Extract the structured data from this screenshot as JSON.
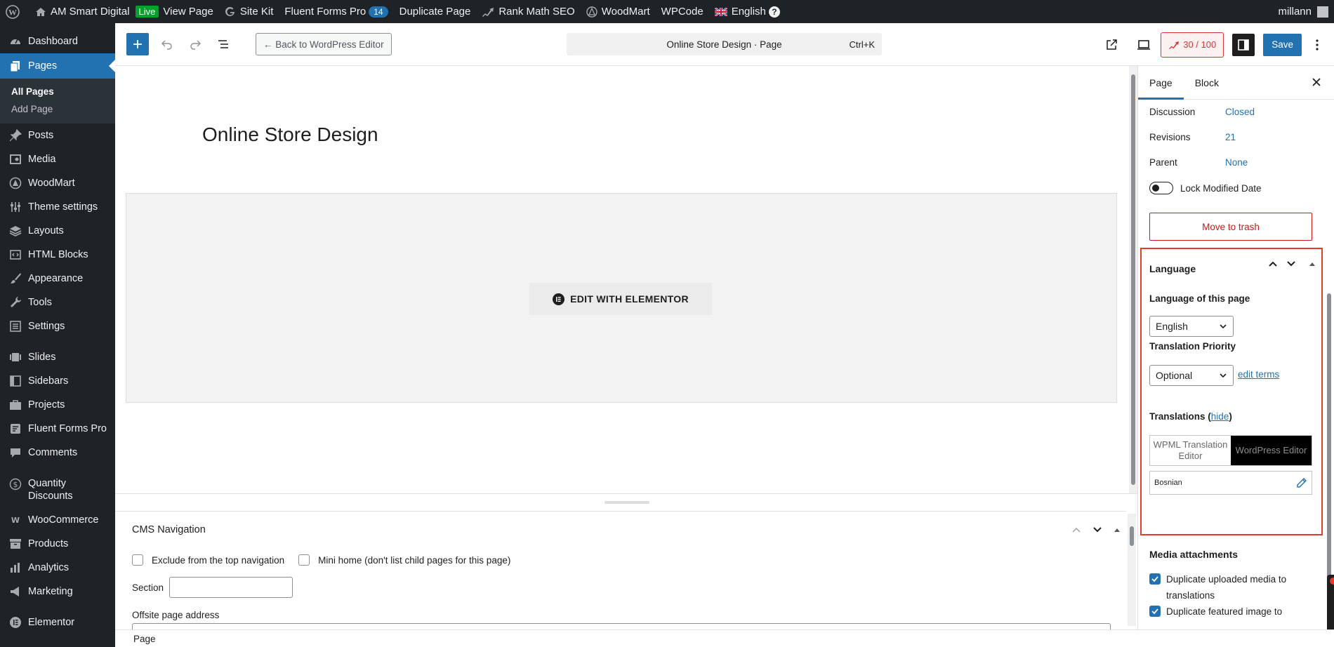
{
  "adminbar": {
    "site_name": "AM Smart Digital",
    "live_badge": "Live",
    "view_page": "View Page",
    "site_kit": "Site Kit",
    "fluent_forms": "Fluent Forms Pro",
    "fluent_count": "14",
    "duplicate_page": "Duplicate Page",
    "rank_math": "Rank Math SEO",
    "woodmart": "WoodMart",
    "wpcode": "WPCode",
    "language": "English",
    "help": "?",
    "user": "millann"
  },
  "sidebar": {
    "items": [
      {
        "label": "Dashboard",
        "icon": "dashboard-icon"
      },
      {
        "label": "Pages",
        "icon": "pages-icon"
      },
      {
        "label": "Posts",
        "icon": "pin-icon"
      },
      {
        "label": "Media",
        "icon": "media-icon"
      },
      {
        "label": "WoodMart",
        "icon": "woodmart-icon"
      },
      {
        "label": "Theme settings",
        "icon": "sliders-icon"
      },
      {
        "label": "Layouts",
        "icon": "layers-icon"
      },
      {
        "label": "HTML Blocks",
        "icon": "code-icon"
      },
      {
        "label": "Appearance",
        "icon": "brush-icon"
      },
      {
        "label": "Tools",
        "icon": "wrench-icon"
      },
      {
        "label": "Settings",
        "icon": "settings-icon"
      },
      {
        "label": "Slides",
        "icon": "slides-icon"
      },
      {
        "label": "Sidebars",
        "icon": "sidebar-icon"
      },
      {
        "label": "Projects",
        "icon": "briefcase-icon"
      },
      {
        "label": "Fluent Forms Pro",
        "icon": "form-icon"
      },
      {
        "label": "Comments",
        "icon": "comment-icon"
      },
      {
        "label": "Quantity Discounts",
        "icon": "dollar-icon"
      },
      {
        "label": "WooCommerce",
        "icon": "woo-icon"
      },
      {
        "label": "Products",
        "icon": "archive-icon"
      },
      {
        "label": "Analytics",
        "icon": "chart-icon"
      },
      {
        "label": "Marketing",
        "icon": "megaphone-icon"
      },
      {
        "label": "Elementor",
        "icon": "elementor-icon"
      }
    ],
    "submenu": [
      "All Pages",
      "Add Page"
    ]
  },
  "header": {
    "back_button": "← Back to WordPress Editor",
    "command_title": "Online Store Design · Page",
    "shortcut": "Ctrl+K",
    "seo_score": "30 / 100",
    "save": "Save"
  },
  "canvas": {
    "page_title": "Online Store Design",
    "elementor_button": "EDIT WITH ELEMENTOR"
  },
  "metabox": {
    "title": "CMS Navigation",
    "exclude_label": "Exclude from the top navigation",
    "mini_home_label": "Mini home (don't list child pages for this page)",
    "section_label": "Section",
    "offsite_label": "Offsite page address"
  },
  "footer": {
    "breadcrumb": "Page"
  },
  "settings": {
    "tabs": [
      "Page",
      "Block"
    ],
    "discussion_label": "Discussion",
    "discussion_value": "Closed",
    "revisions_label": "Revisions",
    "revisions_value": "21",
    "parent_label": "Parent",
    "parent_value": "None",
    "lock_label": "Lock Modified Date",
    "trash": "Move to trash",
    "language": {
      "title": "Language",
      "this_page_label": "Language of this page",
      "selected_language": "English",
      "priority_label": "Translation Priority",
      "selected_priority": "Optional",
      "edit_terms": "edit terms",
      "translations_label": "Translations (",
      "hide": "hide",
      "translations_close": ")",
      "tab_wpml": "WPML Translation Editor",
      "tab_wp": "WordPress Editor",
      "bosnian": "Bosnian"
    },
    "media": {
      "title": "Media attachments",
      "dup_media": "Duplicate uploaded media to translations",
      "dup_featured": "Duplicate featured image to"
    }
  },
  "colors": {
    "admin_dark": "#1d2327",
    "wp_blue": "#2271b1",
    "highlight_red": "#e53b2c"
  }
}
